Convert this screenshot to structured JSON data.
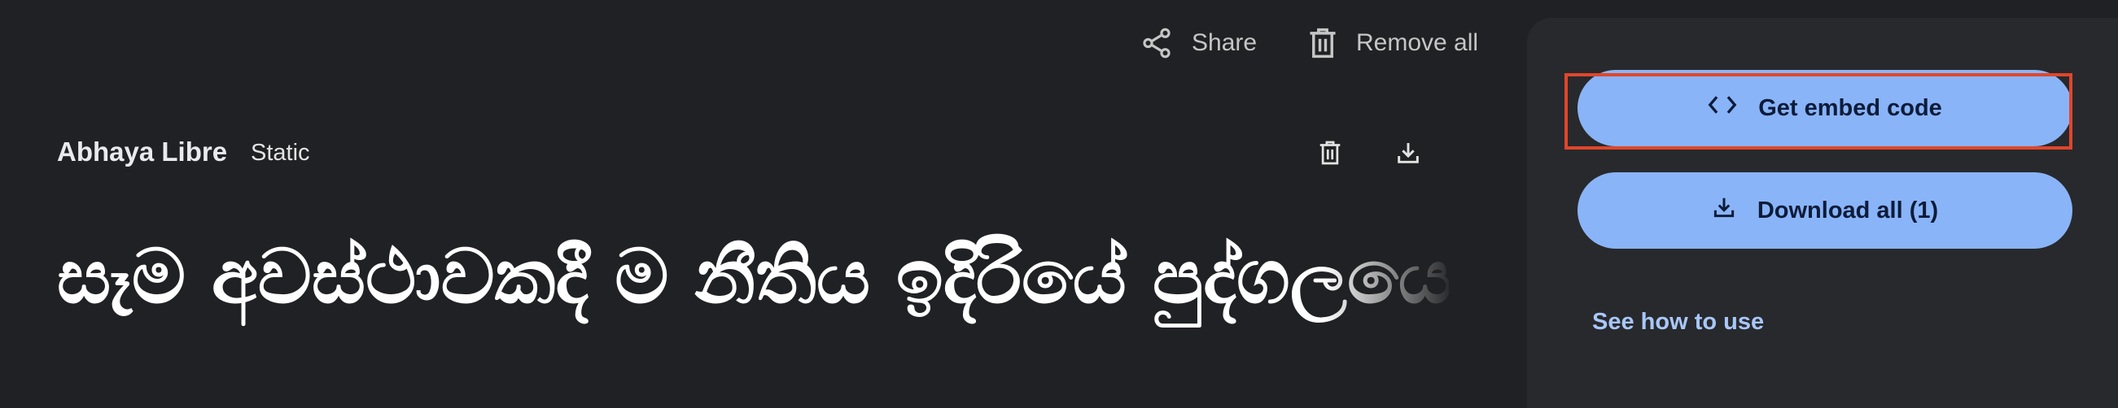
{
  "toolbar": {
    "share_label": "Share",
    "share_icon": "share-icon",
    "remove_all_label": "Remove all",
    "remove_all_icon": "trash-icon"
  },
  "font_card": {
    "family": "Abhaya Libre",
    "style": "Static",
    "delete_icon": "trash-icon",
    "download_icon": "download-icon",
    "sample_text": "සෑම අවස්ථාවකදී ම නීතිය ඉදිරියේ පුද්ගලයෙ"
  },
  "side_panel": {
    "embed_label": "Get embed code",
    "embed_icon": "code-brackets-icon",
    "download_all_label": "Download all (1)",
    "download_all_icon": "download-icon",
    "how_to_label": "See how to use"
  },
  "colors": {
    "background": "#202124",
    "panel": "#28292c",
    "button": "#8ab4f8",
    "link": "#a8c7fa",
    "highlight": "#e0462c"
  }
}
